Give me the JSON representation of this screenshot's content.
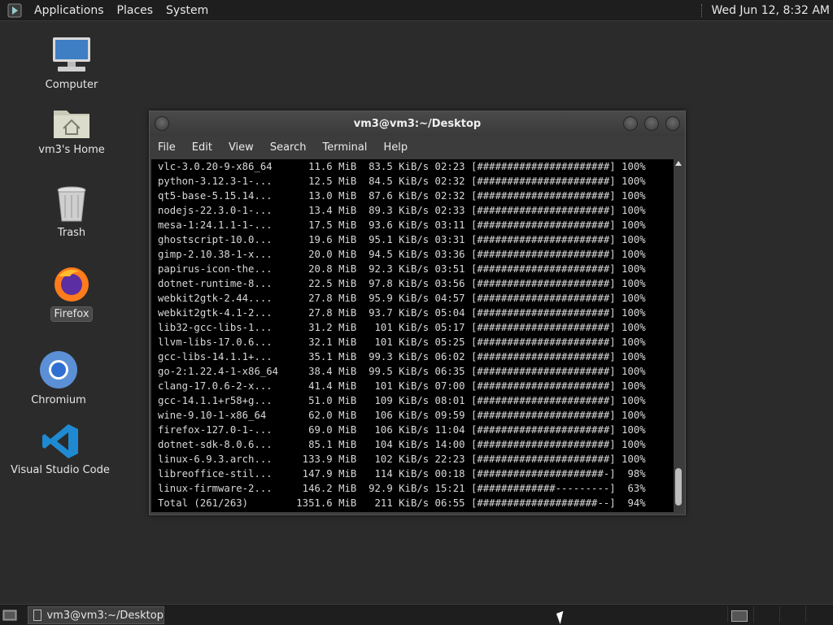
{
  "top_panel": {
    "menus": [
      "Applications",
      "Places",
      "System"
    ],
    "clock": "Wed Jun 12,  8:32 AM"
  },
  "desktop": {
    "icons": [
      {
        "label": "Computer"
      },
      {
        "label": "vm3's Home"
      },
      {
        "label": "Trash"
      },
      {
        "label": "Firefox"
      },
      {
        "label": "Chromium"
      },
      {
        "label": "Visual Studio Code"
      }
    ]
  },
  "terminal": {
    "title": "vm3@vm3:~/Desktop",
    "menu": [
      "File",
      "Edit",
      "View",
      "Search",
      "Terminal",
      "Help"
    ],
    "lines": [
      "vlc-3.0.20-9-x86_64      11.6 MiB  83.5 KiB/s 02:23 [######################] 100%",
      "python-3.12.3-1-...      12.5 MiB  84.5 KiB/s 02:32 [######################] 100%",
      "qt5-base-5.15.14...      13.0 MiB  87.6 KiB/s 02:32 [######################] 100%",
      "nodejs-22.3.0-1-...      13.4 MiB  89.3 KiB/s 02:33 [######################] 100%",
      "mesa-1:24.1.1-1-...      17.5 MiB  93.6 KiB/s 03:11 [######################] 100%",
      "ghostscript-10.0...      19.6 MiB  95.1 KiB/s 03:31 [######################] 100%",
      "gimp-2.10.38-1-x...      20.0 MiB  94.5 KiB/s 03:36 [######################] 100%",
      "papirus-icon-the...      20.8 MiB  92.3 KiB/s 03:51 [######################] 100%",
      "dotnet-runtime-8...      22.5 MiB  97.8 KiB/s 03:56 [######################] 100%",
      "webkit2gtk-2.44....      27.8 MiB  95.9 KiB/s 04:57 [######################] 100%",
      "webkit2gtk-4.1-2...      27.8 MiB  93.7 KiB/s 05:04 [######################] 100%",
      "lib32-gcc-libs-1...      31.2 MiB   101 KiB/s 05:17 [######################] 100%",
      "llvm-libs-17.0.6...      32.1 MiB   101 KiB/s 05:25 [######################] 100%",
      "gcc-libs-14.1.1+...      35.1 MiB  99.3 KiB/s 06:02 [######################] 100%",
      "go-2:1.22.4-1-x86_64     38.4 MiB  99.5 KiB/s 06:35 [######################] 100%",
      "clang-17.0.6-2-x...      41.4 MiB   101 KiB/s 07:00 [######################] 100%",
      "gcc-14.1.1+r58+g...      51.0 MiB   109 KiB/s 08:01 [######################] 100%",
      "wine-9.10-1-x86_64       62.0 MiB   106 KiB/s 09:59 [######################] 100%",
      "firefox-127.0-1-...      69.0 MiB   106 KiB/s 11:04 [######################] 100%",
      "dotnet-sdk-8.0.6...      85.1 MiB   104 KiB/s 14:00 [######################] 100%",
      "linux-6.9.3.arch...     133.9 MiB   102 KiB/s 22:23 [######################] 100%",
      "libreoffice-stil...     147.9 MiB   114 KiB/s 00:18 [#####################-]  98%",
      "linux-firmware-2...     146.2 MiB  92.9 KiB/s 15:21 [#############---------]  63%",
      "Total (261/263)        1351.6 MiB   211 KiB/s 06:55 [####################--]  94%"
    ]
  },
  "taskbar": {
    "task_label": "vm3@vm3:~/Desktop"
  }
}
